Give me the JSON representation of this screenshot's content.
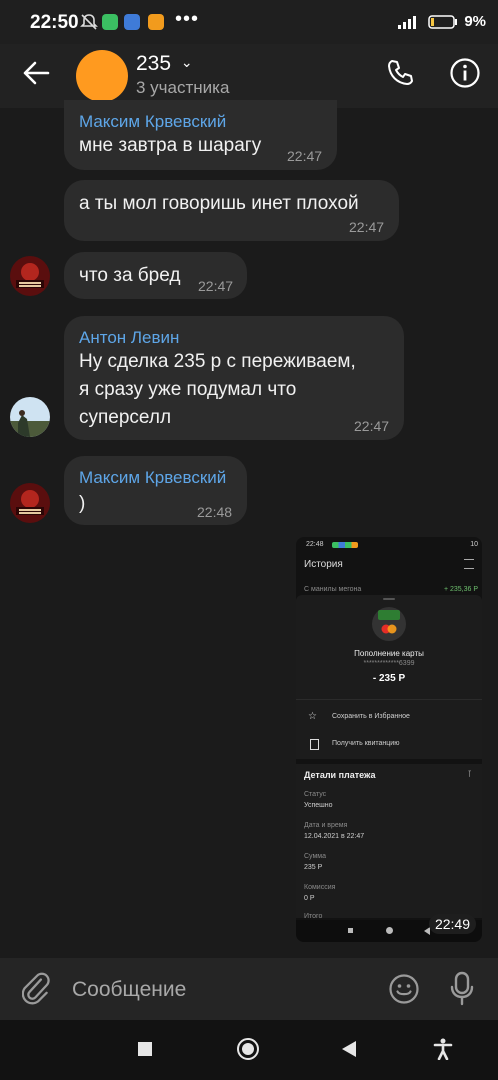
{
  "status_bar": {
    "time": "22:50",
    "dots": "•••",
    "battery_percent": "9",
    "battery_symbol": "%"
  },
  "header": {
    "title": "235",
    "subtitle": "3 участника"
  },
  "messages": [
    {
      "sender": "Максим Крвевский",
      "text": "мне завтра в шарагу",
      "time": "22:47"
    },
    {
      "sender": "",
      "text": "а ты мол говоришь инет плохой",
      "time": "22:47"
    },
    {
      "sender": "",
      "text": "что за бред",
      "time": "22:47"
    },
    {
      "sender": "Антон Левин",
      "text_lines": [
        "Ну сделка 235 р с переживаем,",
        "я сразу уже подумал что",
        "суперселл"
      ],
      "time": "22:47"
    },
    {
      "sender": "Максим Крвевский",
      "text": ")",
      "time": "22:48"
    }
  ],
  "attachment": {
    "time": "22:49",
    "status_time": "22:48",
    "battery": "10",
    "header": "История",
    "row_partial": "С манилы мегона",
    "row_amount": "+ 235,36 Р",
    "title": "Пополнение карты",
    "card_mask": "*************6399",
    "amount": "- 235 Р",
    "actions": [
      "Сохранить в Избранное",
      "Получить квитанцию"
    ],
    "details_title": "Детали платежа",
    "details": [
      {
        "label": "Статус",
        "value": "Успешно"
      },
      {
        "label": "Дата и время",
        "value": "12.04.2021 в 22:47"
      },
      {
        "label": "Сумма",
        "value": "235 Р"
      },
      {
        "label": "Комиссия",
        "value": "0 Р"
      },
      {
        "label": "Итого",
        "value": ""
      }
    ]
  },
  "composer": {
    "placeholder": "Сообщение"
  },
  "colors": {
    "accent": "#5ea6e8",
    "avatar_orange": "#ff9a1f",
    "bubble": "#2c2c2c"
  }
}
